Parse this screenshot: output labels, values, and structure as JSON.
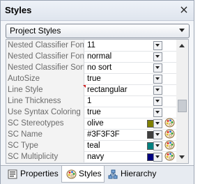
{
  "window": {
    "title": "Styles",
    "close_label": "×"
  },
  "styles_dropdown": {
    "selected": "Project Styles"
  },
  "grid": {
    "rows": [
      {
        "name": "Nested Classifier Font",
        "value": "11",
        "kind": "combo"
      },
      {
        "name": "Nested Classifier Font",
        "value": "normal",
        "kind": "combo"
      },
      {
        "name": "Nested Classifier Sort",
        "value": "no sort",
        "kind": "combo"
      },
      {
        "name": "AutoSize",
        "value": "true",
        "kind": "combo"
      },
      {
        "name": "Line Style",
        "value": "rectangular",
        "kind": "combo",
        "marker": true
      },
      {
        "name": "Line Thickness",
        "value": "1",
        "kind": "combo"
      },
      {
        "name": "Use Syntax Coloring",
        "value": "true",
        "kind": "combo"
      },
      {
        "name": "SC Stereotypes",
        "value": "olive",
        "kind": "color",
        "color": "#808000"
      },
      {
        "name": "SC Name",
        "value": "#3F3F3F",
        "kind": "color",
        "color": "#3F3F3F"
      },
      {
        "name": "SC Type",
        "value": "teal",
        "kind": "color",
        "color": "#008080"
      },
      {
        "name": "SC Multiplicity",
        "value": "navy",
        "kind": "color",
        "color": "#000080"
      }
    ]
  },
  "scrollbar": {
    "position": 0.55
  },
  "tabs": [
    {
      "label": "Properties",
      "icon": "properties-icon",
      "active": false
    },
    {
      "label": "Styles",
      "icon": "palette-icon",
      "active": true
    },
    {
      "label": "Hierarchy",
      "icon": "hierarchy-icon",
      "active": false
    }
  ]
}
